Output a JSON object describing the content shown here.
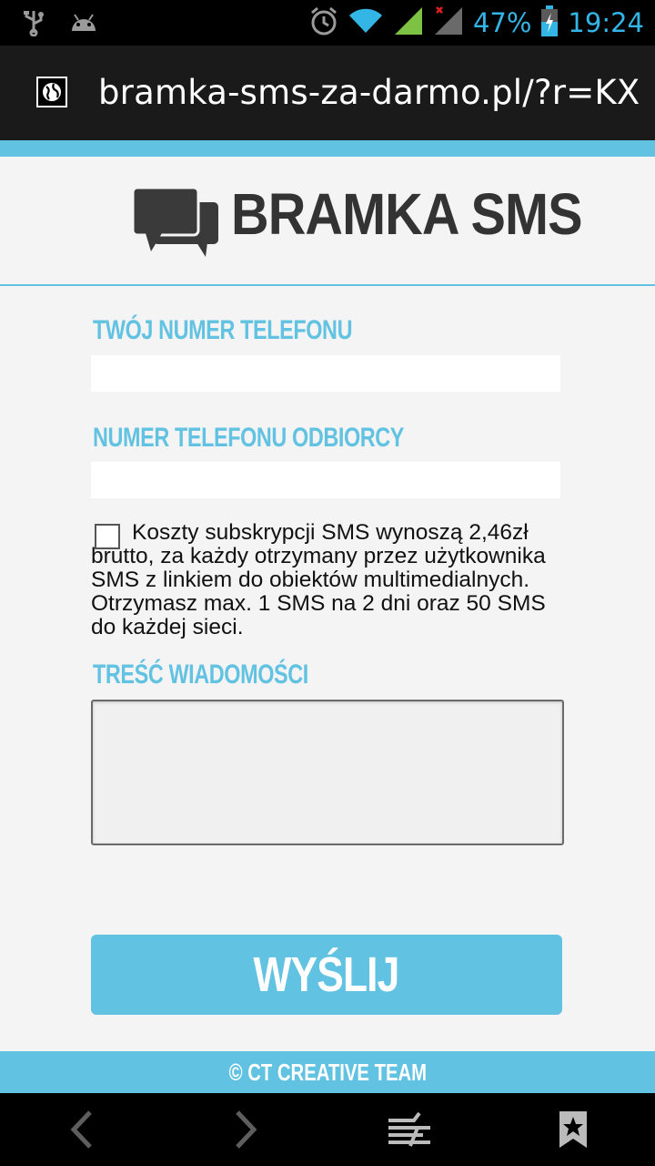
{
  "status_bar": {
    "battery": "47%",
    "time": "19:24"
  },
  "browser": {
    "url": "bramka-sms-za-darmo.pl/?r=KX"
  },
  "header": {
    "logo_text": "BRAMKA SMS"
  },
  "form": {
    "sender_label": "TWÓJ NUMER TELEFONU",
    "sender_value": "",
    "recipient_label": "NUMER TELEFONU ODBIORCY",
    "recipient_value": "",
    "consent_checked": false,
    "consent_text": "Koszty subskrypcji SMS wynoszą 2,46zł brutto, za każdy otrzymany przez użytkownika SMS z linkiem do obiektów multimedialnych. Otrzymasz max. 1 SMS na 2 dni oraz 50 SMS do każdej sieci.",
    "message_label": "TREŚĆ WIADOMOŚCI",
    "message_value": "",
    "send_label": "WYŚLIJ"
  },
  "footer": {
    "text": "© CT CREATIVE TEAM"
  },
  "colors": {
    "accent": "#62c2e2",
    "statusbar_icons": "#33b5e5",
    "logo": "#333333"
  }
}
